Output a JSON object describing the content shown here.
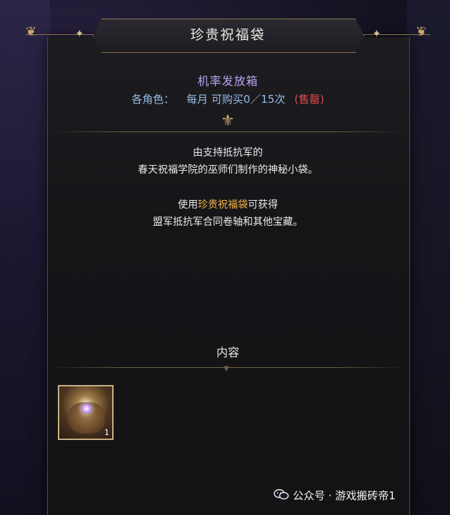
{
  "window": {
    "title": "珍贵祝福袋"
  },
  "item": {
    "type_label": "机率发放箱",
    "limit_label": "各角色：",
    "limit_value": "每月 可购买0／15次",
    "limit_status": "(售罄)",
    "status_color": "#e24a4a",
    "accent_color": "#b9a2ec",
    "highlight_color": "#f0b24a"
  },
  "description": {
    "line1": "由支持抵抗军的",
    "line2": "春天祝福学院的巫师们制作的神秘小袋。",
    "line3_prefix": "使用",
    "line3_highlight": "珍贵祝福袋",
    "line3_suffix": "可获得",
    "line4": "盟军抵抗军合同卷轴和其他宝藏。"
  },
  "contents": {
    "label": "内容",
    "items": [
      {
        "icon": "blessing-bag-icon",
        "count": "1"
      }
    ]
  },
  "watermark": {
    "text": "公众号 · 游戏搬砖帝1",
    "icon": "wechat-icon"
  }
}
